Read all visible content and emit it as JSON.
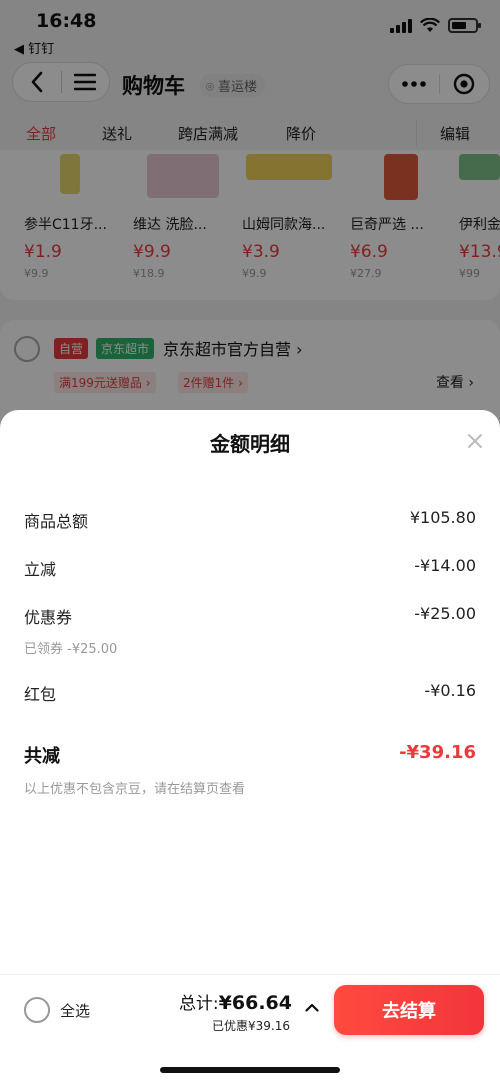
{
  "status_bar": {
    "time": "16:48",
    "back_app": "◀ 钉钉"
  },
  "nav": {
    "title": "购物车",
    "location": "喜运楼"
  },
  "filter_tabs": [
    {
      "label": "全部",
      "active": true
    },
    {
      "label": "送礼",
      "active": false
    },
    {
      "label": "跨店满减",
      "active": false
    },
    {
      "label": "降价",
      "active": false
    },
    {
      "label": "编辑",
      "active": false
    }
  ],
  "products": [
    {
      "name": "参半C11牙...",
      "price": "¥1.9",
      "orig": "¥9.9",
      "color": "#e8d86a"
    },
    {
      "name": "维达 洗脸...",
      "price": "¥9.9",
      "orig": "¥18.9",
      "color": "#e9c9d6"
    },
    {
      "name": "山姆同款海...",
      "price": "¥3.9",
      "orig": "¥9.9",
      "color": "#f2d35a"
    },
    {
      "name": "巨奇严选 ...",
      "price": "¥6.9",
      "orig": "¥27.9",
      "color": "#e05a3a"
    },
    {
      "name": "伊利金...",
      "price": "¥13.9",
      "orig": "¥99",
      "color": "#7fc48a"
    }
  ],
  "shop": {
    "tag_self": "自营",
    "tag_jd": "京东超市",
    "name": "京东超市官方自营 ›",
    "promo1": "满199元送赠品 ›",
    "promo2": "2件赠1件 ›",
    "see_more": "查看 ›"
  },
  "sheet": {
    "title": "金额明细",
    "rows": [
      {
        "label": "商品总额",
        "value": "¥105.80"
      },
      {
        "label": "立减",
        "value": "-¥14.00"
      },
      {
        "label": "优惠券",
        "value": "-¥25.00",
        "sub": "已领券 -¥25.00"
      },
      {
        "label": "红包",
        "value": "-¥0.16"
      }
    ],
    "total_label": "共减",
    "total_value": "-¥39.16",
    "note": "以上优惠不包含京豆，请在结算页查看"
  },
  "bottom": {
    "select_all": "全选",
    "sum_label": "总计:",
    "sum_value": "¥66.64",
    "saved": "已优惠¥39.16",
    "checkout": "去结算"
  },
  "colors": {
    "accent": "#e93b3d",
    "jd_green": "#2fb36b"
  }
}
